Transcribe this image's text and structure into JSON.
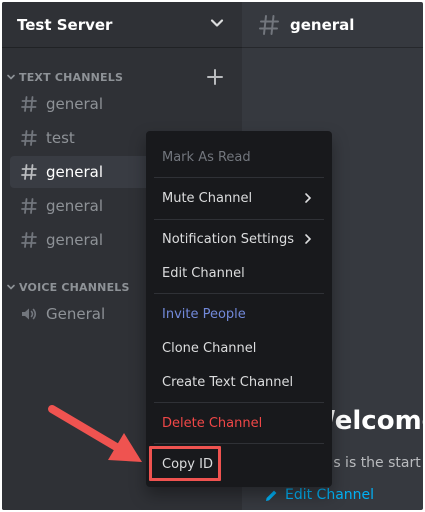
{
  "server": {
    "name": "Test Server"
  },
  "categories": {
    "text": "TEXT CHANNELS",
    "voice": "VOICE CHANNELS"
  },
  "text_channels": [
    {
      "label": "general",
      "active": false
    },
    {
      "label": "test",
      "active": false
    },
    {
      "label": "general",
      "active": true
    },
    {
      "label": "general",
      "active": false
    },
    {
      "label": "general",
      "active": false
    }
  ],
  "voice_channels": [
    {
      "label": "General"
    }
  ],
  "main": {
    "title": "general",
    "welcome": "Welcome to",
    "start_text": "This is the start of the #general channel.",
    "edit_link": "Edit Channel"
  },
  "context_menu": {
    "items": [
      {
        "label": "Mark As Read"
      },
      {
        "label": "Mute Channel"
      },
      {
        "label": "Notification Settings"
      },
      {
        "label": "Edit Channel"
      },
      {
        "label": "Invite People"
      },
      {
        "label": "Clone Channel"
      },
      {
        "label": "Create Text Channel"
      },
      {
        "label": "Delete Channel"
      },
      {
        "label": "Copy ID"
      }
    ]
  },
  "colors": {
    "sidebar": "#2f3136",
    "main": "#36393f",
    "menu": "#18191c",
    "accent_blue": "#7289da",
    "danger_red": "#f04747",
    "annotation_red": "#ef5350",
    "link": "#00b0f4"
  }
}
